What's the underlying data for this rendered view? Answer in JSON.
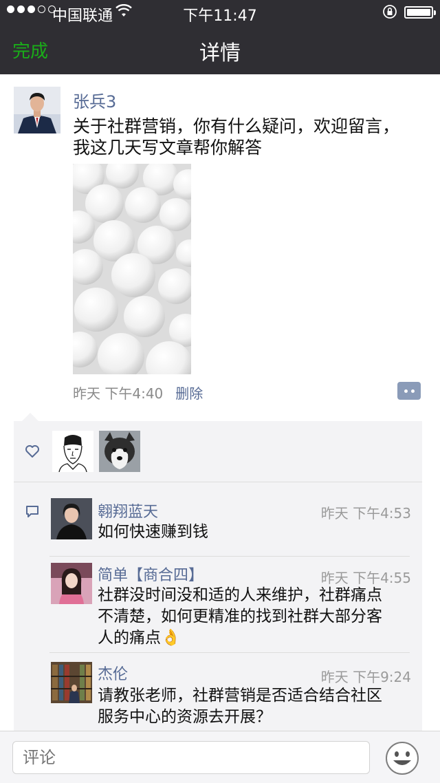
{
  "status_bar": {
    "carrier": "中国联通",
    "time": "下午11:47"
  },
  "nav": {
    "done_label": "完成",
    "title": "详情"
  },
  "post": {
    "author": "张兵3",
    "text_lines": [
      "关于社群营销，你有什么疑问，欢迎留言，",
      "我这几天写文章帮你解答"
    ],
    "time": "昨天 下午4:40",
    "delete_label": "删除"
  },
  "comments": [
    {
      "name": "翱翔蓝天",
      "time": "昨天 下午4:53",
      "lines": [
        "如何快速赚到钱"
      ]
    },
    {
      "name": "简单【商合四】",
      "time": "昨天 下午4:55",
      "lines": [
        "社群没时间没和适的人来维护，社群痛点",
        "不清楚，如何更精准的找到社群大部分客",
        "人的痛点👌"
      ]
    },
    {
      "name": "杰伦",
      "time": "昨天 下午9:24",
      "lines": [
        "请教张老师，社群营销是否适合结合社区",
        "服务中心的资源去开展？"
      ]
    }
  ],
  "input": {
    "placeholder": "评论"
  },
  "icons": {
    "signal": "signal-dots-icon",
    "wifi": "wifi-icon",
    "lock": "orientation-lock-icon",
    "battery": "battery-icon",
    "like": "heart-icon",
    "comment": "comment-bubble-icon",
    "more": "comment-toggle-icon",
    "emoji": "emoji-icon"
  },
  "colors": {
    "nav_bg": "#2f2e33",
    "accent_green": "#1aad19",
    "link_blue": "#576b95",
    "box_bg": "#f3f3f5"
  }
}
